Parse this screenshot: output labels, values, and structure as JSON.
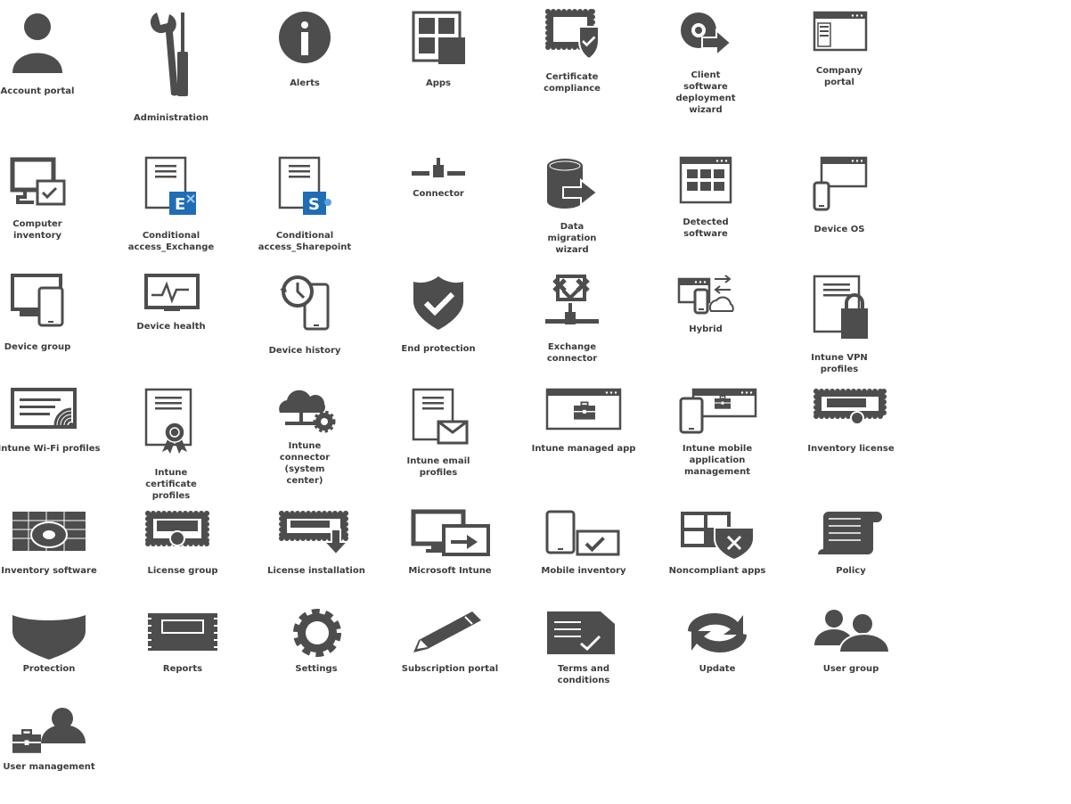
{
  "icons": [
    {
      "label": "Account portal",
      "icon": "person-icon"
    },
    {
      "label": "Administration",
      "icon": "wrench-screwdriver-icon"
    },
    {
      "label": "Alerts",
      "icon": "info-icon"
    },
    {
      "label": "Apps",
      "icon": "apps-grid-icon"
    },
    {
      "label": "Certificate\ncompliance",
      "icon": "certificate-shield-icon"
    },
    {
      "label": "Client\nsoftware\ndeployment\nwizard",
      "icon": "disc-arrow-icon"
    },
    {
      "label": "Company\nportal",
      "icon": "browser-window-icon"
    },
    {
      "label": "Computer\ninventory",
      "icon": "monitor-check-icon"
    },
    {
      "label": "Conditional\naccess_Exchange",
      "icon": "document-exchange-icon"
    },
    {
      "label": "Conditional\naccess_Sharepoint",
      "icon": "document-sharepoint-icon"
    },
    {
      "label": "Connector",
      "icon": "connector-icon"
    },
    {
      "label": "Data\nmigration\nwizard",
      "icon": "database-arrow-icon"
    },
    {
      "label": "Detected\nsoftware",
      "icon": "window-grid-icon"
    },
    {
      "label": "Device OS",
      "icon": "phone-window-icon"
    },
    {
      "label": "Device group",
      "icon": "monitor-phone-icon"
    },
    {
      "label": "Device health",
      "icon": "heartbeat-monitor-icon"
    },
    {
      "label": "Device history",
      "icon": "clock-phone-icon"
    },
    {
      "label": "End protection",
      "icon": "shield-check-icon"
    },
    {
      "label": "Exchange\nconnector",
      "icon": "exchange-connector-icon"
    },
    {
      "label": "Hybrid",
      "icon": "hybrid-cloud-icon"
    },
    {
      "label": "Intune VPN\nprofiles",
      "icon": "document-lock-icon"
    },
    {
      "label": "Intune Wi-Fi profiles",
      "icon": "wifi-certificate-icon"
    },
    {
      "label": "Intune\ncertificate\nprofiles",
      "icon": "document-ribbon-icon"
    },
    {
      "label": "Intune\nconnector\n(system\ncenter)",
      "icon": "cloud-gear-icon"
    },
    {
      "label": "Intune email\nprofiles",
      "icon": "document-envelope-icon"
    },
    {
      "label": "Intune managed app",
      "icon": "window-toolbox-icon"
    },
    {
      "label": "Intune mobile\napplication\nmanagement",
      "icon": "phone-window-toolbox-icon"
    },
    {
      "label": "Inventory license",
      "icon": "license-certificate-icon"
    },
    {
      "label": "Inventory software",
      "icon": "table-disc-icon"
    },
    {
      "label": "License group",
      "icon": "license-group-icon"
    },
    {
      "label": "License installation",
      "icon": "license-download-icon"
    },
    {
      "label": "Microsoft Intune",
      "icon": "monitors-arrow-icon"
    },
    {
      "label": "Mobile inventory",
      "icon": "phone-checklist-icon"
    },
    {
      "label": "Noncompliant apps",
      "icon": "apps-shield-x-icon"
    },
    {
      "label": "Policy",
      "icon": "scroll-icon"
    },
    {
      "label": "Protection",
      "icon": "shield-wide-icon"
    },
    {
      "label": "Reports",
      "icon": "notebook-icon"
    },
    {
      "label": "Settings",
      "icon": "gear-icon"
    },
    {
      "label": "Subscription portal",
      "icon": "pencil-icon"
    },
    {
      "label": "Terms and conditions",
      "icon": "document-check-icon"
    },
    {
      "label": "Update",
      "icon": "refresh-icon"
    },
    {
      "label": "User group",
      "icon": "users-icon"
    },
    {
      "label": "User management",
      "icon": "user-toolbox-icon"
    }
  ],
  "colors": {
    "icon": "#4d4d4d",
    "label": "#3c3c3c",
    "accent_blue": "#1e6db5"
  }
}
